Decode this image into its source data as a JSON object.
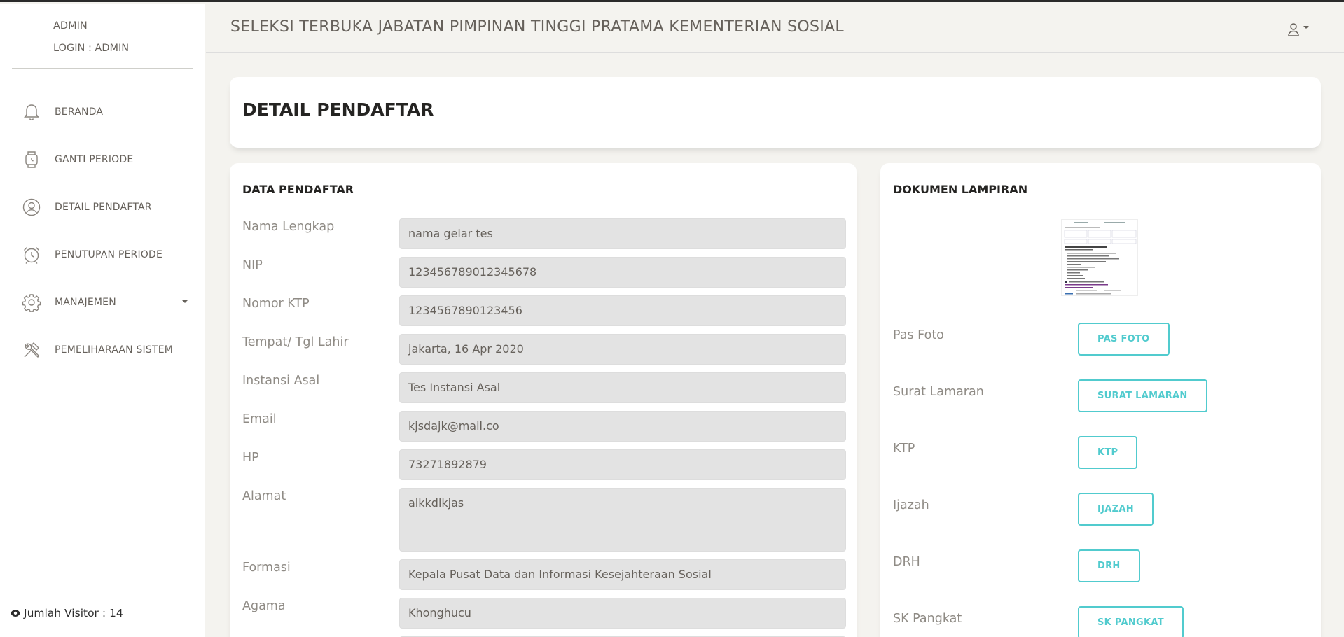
{
  "sidebar": {
    "user_name": "ADMIN",
    "login_info": "LOGIN : ADMIN",
    "items": [
      {
        "label": "BERANDA",
        "icon": "bell-icon"
      },
      {
        "label": "GANTI PERIODE",
        "icon": "watch-icon"
      },
      {
        "label": "DETAIL PENDAFTAR",
        "icon": "user-circle-icon"
      },
      {
        "label": "PENUTUPAN PERIODE",
        "icon": "alarm-clock-icon"
      },
      {
        "label": "MANAJEMEN",
        "icon": "gear-icon"
      },
      {
        "label": "PEMELIHARAAN SISTEM",
        "icon": "tools-icon"
      }
    ],
    "visitor_label": "Jumlah Visitor : 14"
  },
  "header": {
    "title": "SELEKSI TERBUKA JABATAN PIMPINAN TINGGI PRATAMA KEMENTERIAN SOSIAL"
  },
  "page": {
    "title": "DETAIL PENDAFTAR"
  },
  "data_pendaftar": {
    "title": "DATA PENDAFTAR",
    "fields": [
      {
        "label": "Nama Lengkap",
        "value": "nama gelar tes"
      },
      {
        "label": "NIP",
        "value": "123456789012345678"
      },
      {
        "label": "Nomor KTP",
        "value": "1234567890123456"
      },
      {
        "label": "Tempat/ Tgl Lahir",
        "value": "jakarta, 16 Apr 2020"
      },
      {
        "label": "Instansi Asal",
        "value": "Tes Instansi Asal"
      },
      {
        "label": "Email",
        "value": "kjsdajk@mail.co"
      },
      {
        "label": "HP",
        "value": "73271892879"
      },
      {
        "label": "Alamat",
        "value": "alkkdlkjas"
      },
      {
        "label": "Formasi",
        "value": "Kepala Pusat Data dan Informasi Kesejahteraan Sosial"
      },
      {
        "label": "Agama",
        "value": "Khonghucu"
      }
    ]
  },
  "dokumen": {
    "title": "DOKUMEN LAMPIRAN",
    "items": [
      {
        "label": "Pas Foto",
        "button": "PAS FOTO"
      },
      {
        "label": "Surat Lamaran",
        "button": "SURAT LAMARAN"
      },
      {
        "label": "KTP",
        "button": "KTP"
      },
      {
        "label": "Ijazah",
        "button": "IJAZAH"
      },
      {
        "label": "DRH",
        "button": "DRH"
      },
      {
        "label": "SK Pangkat",
        "button": "SK PANGKAT"
      }
    ]
  },
  "colors": {
    "accent": "#51cbce",
    "background": "#f4f3ef",
    "input_bg": "#e3e3e3"
  }
}
